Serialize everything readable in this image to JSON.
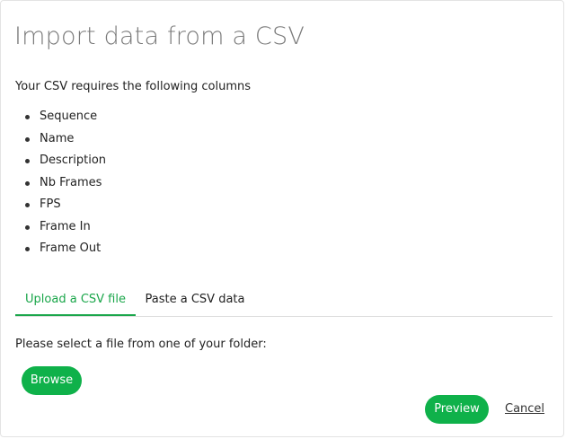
{
  "dialog": {
    "title": "Import data from a CSV",
    "intro": "Your CSV requires the following columns",
    "columns": [
      "Sequence",
      "Name",
      "Description",
      "Nb Frames",
      "FPS",
      "Frame In",
      "Frame Out"
    ]
  },
  "tabs": [
    {
      "label": "Upload a CSV file",
      "active": true
    },
    {
      "label": "Paste a CSV data",
      "active": false
    }
  ],
  "upload": {
    "instruction": "Please select a file from one of your folder:",
    "browse_label": "Browse"
  },
  "footer": {
    "preview_label": "Preview",
    "cancel_label": "Cancel"
  },
  "colors": {
    "accent": "#0fb14a",
    "title": "#7a7a7a",
    "text": "#222222"
  }
}
